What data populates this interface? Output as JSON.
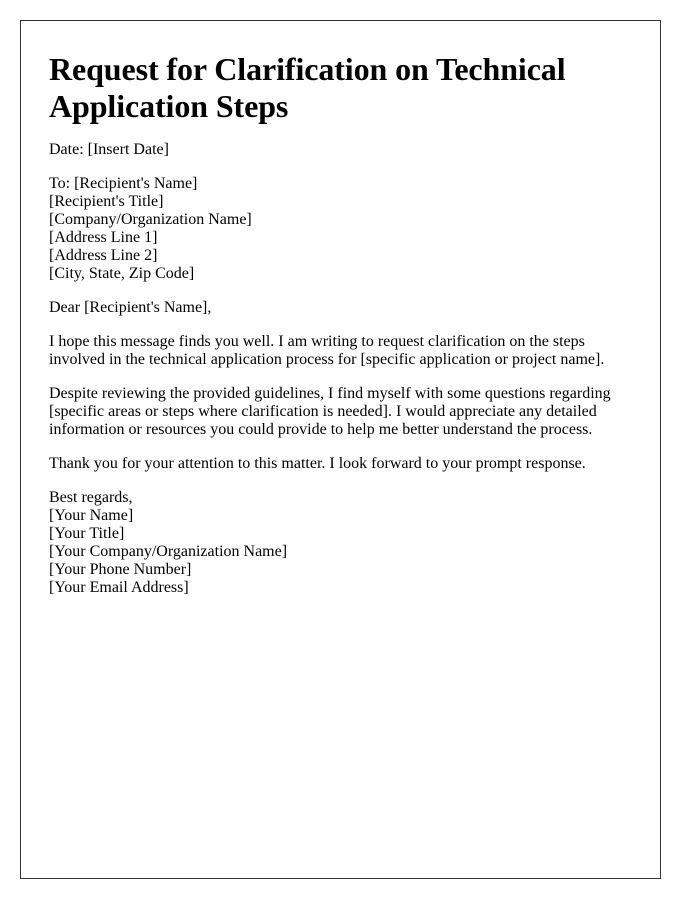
{
  "document": {
    "title": "Request for Clarification on Technical Application Steps",
    "date_line": "Date: [Insert Date]",
    "recipient": {
      "lines": [
        "To: [Recipient's Name]",
        "[Recipient's Title]",
        "[Company/Organization Name]",
        "[Address Line 1]",
        "[Address Line 2]",
        "[City, State, Zip Code]"
      ]
    },
    "salutation": "Dear [Recipient's Name],",
    "body_paragraphs": [
      "I hope this message finds you well. I am writing to request clarification on the steps involved in the technical application process for [specific application or project name].",
      "Despite reviewing the provided guidelines, I find myself with some questions regarding [specific areas or steps where clarification is needed]. I would appreciate any detailed information or resources you could provide to help me better understand the process.",
      "Thank you for your attention to this matter. I look forward to your prompt response."
    ],
    "closing": {
      "lines": [
        "Best regards,",
        "[Your Name]",
        "[Your Title]",
        "[Your Company/Organization Name]",
        "[Your Phone Number]",
        "[Your Email Address]"
      ]
    }
  }
}
